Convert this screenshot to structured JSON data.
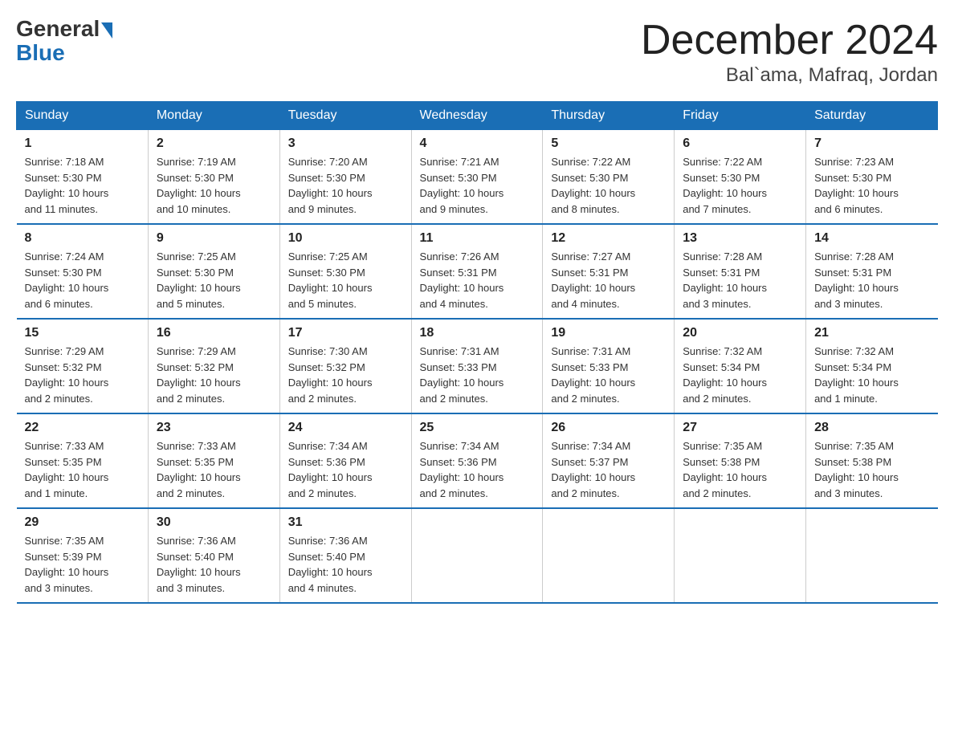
{
  "logo": {
    "general": "General",
    "blue": "Blue"
  },
  "title": {
    "month": "December 2024",
    "location": "Bal`ama, Mafraq, Jordan"
  },
  "headers": [
    "Sunday",
    "Monday",
    "Tuesday",
    "Wednesday",
    "Thursday",
    "Friday",
    "Saturday"
  ],
  "weeks": [
    [
      {
        "day": "1",
        "sunrise": "7:18 AM",
        "sunset": "5:30 PM",
        "daylight": "10 hours and 11 minutes."
      },
      {
        "day": "2",
        "sunrise": "7:19 AM",
        "sunset": "5:30 PM",
        "daylight": "10 hours and 10 minutes."
      },
      {
        "day": "3",
        "sunrise": "7:20 AM",
        "sunset": "5:30 PM",
        "daylight": "10 hours and 9 minutes."
      },
      {
        "day": "4",
        "sunrise": "7:21 AM",
        "sunset": "5:30 PM",
        "daylight": "10 hours and 9 minutes."
      },
      {
        "day": "5",
        "sunrise": "7:22 AM",
        "sunset": "5:30 PM",
        "daylight": "10 hours and 8 minutes."
      },
      {
        "day": "6",
        "sunrise": "7:22 AM",
        "sunset": "5:30 PM",
        "daylight": "10 hours and 7 minutes."
      },
      {
        "day": "7",
        "sunrise": "7:23 AM",
        "sunset": "5:30 PM",
        "daylight": "10 hours and 6 minutes."
      }
    ],
    [
      {
        "day": "8",
        "sunrise": "7:24 AM",
        "sunset": "5:30 PM",
        "daylight": "10 hours and 6 minutes."
      },
      {
        "day": "9",
        "sunrise": "7:25 AM",
        "sunset": "5:30 PM",
        "daylight": "10 hours and 5 minutes."
      },
      {
        "day": "10",
        "sunrise": "7:25 AM",
        "sunset": "5:30 PM",
        "daylight": "10 hours and 5 minutes."
      },
      {
        "day": "11",
        "sunrise": "7:26 AM",
        "sunset": "5:31 PM",
        "daylight": "10 hours and 4 minutes."
      },
      {
        "day": "12",
        "sunrise": "7:27 AM",
        "sunset": "5:31 PM",
        "daylight": "10 hours and 4 minutes."
      },
      {
        "day": "13",
        "sunrise": "7:28 AM",
        "sunset": "5:31 PM",
        "daylight": "10 hours and 3 minutes."
      },
      {
        "day": "14",
        "sunrise": "7:28 AM",
        "sunset": "5:31 PM",
        "daylight": "10 hours and 3 minutes."
      }
    ],
    [
      {
        "day": "15",
        "sunrise": "7:29 AM",
        "sunset": "5:32 PM",
        "daylight": "10 hours and 2 minutes."
      },
      {
        "day": "16",
        "sunrise": "7:29 AM",
        "sunset": "5:32 PM",
        "daylight": "10 hours and 2 minutes."
      },
      {
        "day": "17",
        "sunrise": "7:30 AM",
        "sunset": "5:32 PM",
        "daylight": "10 hours and 2 minutes."
      },
      {
        "day": "18",
        "sunrise": "7:31 AM",
        "sunset": "5:33 PM",
        "daylight": "10 hours and 2 minutes."
      },
      {
        "day": "19",
        "sunrise": "7:31 AM",
        "sunset": "5:33 PM",
        "daylight": "10 hours and 2 minutes."
      },
      {
        "day": "20",
        "sunrise": "7:32 AM",
        "sunset": "5:34 PM",
        "daylight": "10 hours and 2 minutes."
      },
      {
        "day": "21",
        "sunrise": "7:32 AM",
        "sunset": "5:34 PM",
        "daylight": "10 hours and 1 minute."
      }
    ],
    [
      {
        "day": "22",
        "sunrise": "7:33 AM",
        "sunset": "5:35 PM",
        "daylight": "10 hours and 1 minute."
      },
      {
        "day": "23",
        "sunrise": "7:33 AM",
        "sunset": "5:35 PM",
        "daylight": "10 hours and 2 minutes."
      },
      {
        "day": "24",
        "sunrise": "7:34 AM",
        "sunset": "5:36 PM",
        "daylight": "10 hours and 2 minutes."
      },
      {
        "day": "25",
        "sunrise": "7:34 AM",
        "sunset": "5:36 PM",
        "daylight": "10 hours and 2 minutes."
      },
      {
        "day": "26",
        "sunrise": "7:34 AM",
        "sunset": "5:37 PM",
        "daylight": "10 hours and 2 minutes."
      },
      {
        "day": "27",
        "sunrise": "7:35 AM",
        "sunset": "5:38 PM",
        "daylight": "10 hours and 2 minutes."
      },
      {
        "day": "28",
        "sunrise": "7:35 AM",
        "sunset": "5:38 PM",
        "daylight": "10 hours and 3 minutes."
      }
    ],
    [
      {
        "day": "29",
        "sunrise": "7:35 AM",
        "sunset": "5:39 PM",
        "daylight": "10 hours and 3 minutes."
      },
      {
        "day": "30",
        "sunrise": "7:36 AM",
        "sunset": "5:40 PM",
        "daylight": "10 hours and 3 minutes."
      },
      {
        "day": "31",
        "sunrise": "7:36 AM",
        "sunset": "5:40 PM",
        "daylight": "10 hours and 4 minutes."
      },
      null,
      null,
      null,
      null
    ]
  ],
  "labels": {
    "sunrise": "Sunrise:",
    "sunset": "Sunset:",
    "daylight": "Daylight:"
  }
}
